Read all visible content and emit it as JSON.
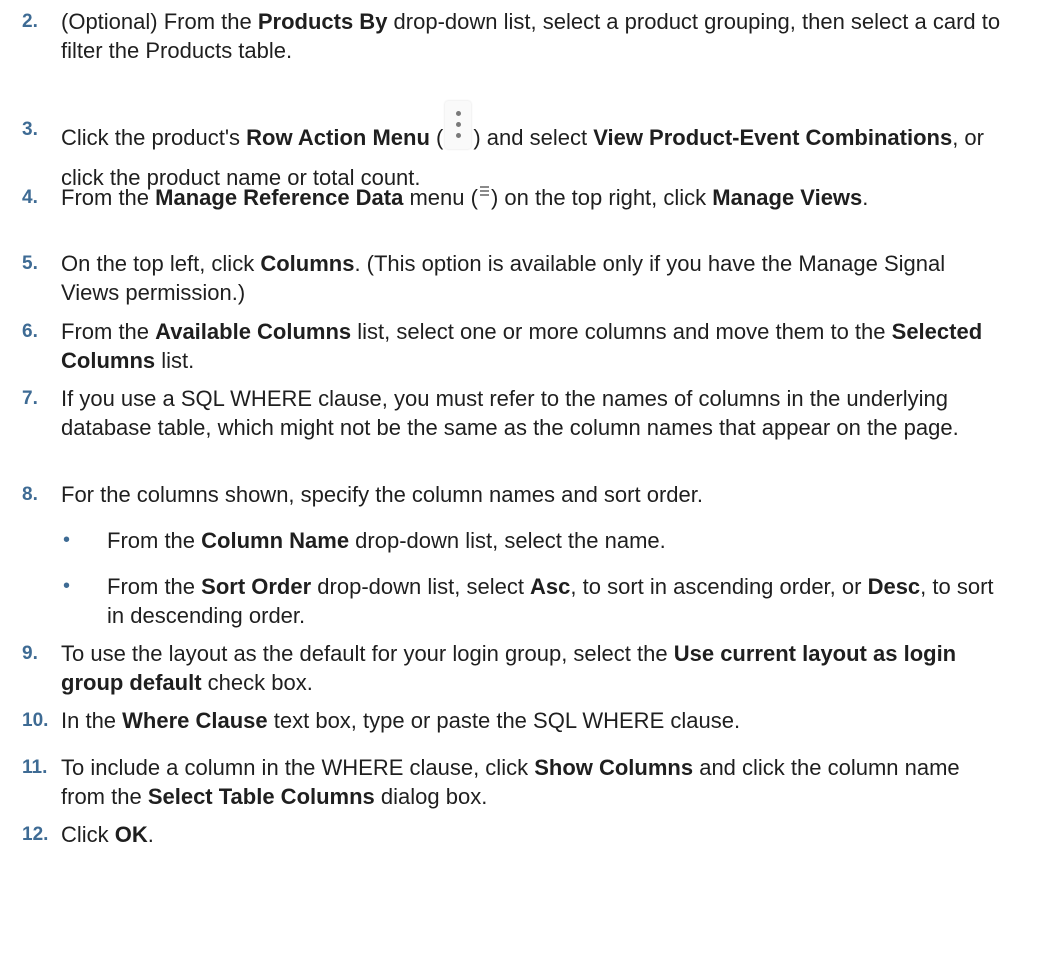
{
  "steps": [
    {
      "num": "2.",
      "parts": [
        "(Optional) From the ",
        "Products By",
        " drop-down list, select a product grouping, then select a card to filter the Products table."
      ]
    },
    {
      "num": "3.",
      "p1": "Click the product's ",
      "b1": "Row Action Menu",
      "p2": " (",
      "p3": ") and select ",
      "b2": "View Product-Event Combinations",
      "p4": ", or click the product name or total count."
    },
    {
      "num": "4.",
      "p1": "From the ",
      "b1": "Manage Reference Data",
      "p2": " menu (",
      "p3": ") on the top right, click ",
      "b2": "Manage Views",
      "p4": "."
    },
    {
      "num": "5.",
      "p1": "On the top left, click ",
      "b1": "Columns",
      "p2": ". (This option is available only if you have the Manage Signal Views permission.)"
    },
    {
      "num": "6.",
      "p1": "From the ",
      "b1": "Available Columns",
      "p2": " list, select one or more columns and move them to the ",
      "b2": "Selected Columns",
      "p3": " list."
    },
    {
      "num": "7.",
      "p1": "If you use a SQL WHERE clause, you must refer to the names of columns in the underlying database table, which might not be the same as the column names that appear on the page."
    },
    {
      "num": "8.",
      "p1": "For the columns shown, specify the column names and sort order."
    },
    {
      "num": "9.",
      "p1": "To use the layout as the default for your login group, select the ",
      "b1": "Use current layout as login group default",
      "p2": " check box."
    },
    {
      "num": "10.",
      "p1": "In the ",
      "b1": "Where Clause",
      "p2": " text box, type or paste the SQL WHERE clause."
    },
    {
      "num": "11.",
      "p1": "To include a column in the WHERE clause, click ",
      "b1": "Show Columns",
      "p2": " and click the column name from the ",
      "b2": "Select Table Columns",
      "p3": " dialog box."
    },
    {
      "num": "12.",
      "p1": "Click ",
      "b1": "OK",
      "p2": "."
    }
  ],
  "substeps": [
    {
      "bullet": "•",
      "p1": "From the ",
      "b1": "Column Name",
      "p2": " drop-down list, select the name."
    },
    {
      "bullet": "•",
      "p1": "From the ",
      "b1": "Sort Order",
      "p2": " drop-down list, select ",
      "b2": "Asc",
      "p3": ", to sort in ascending order, or ",
      "b3": "Desc",
      "p4": ", to sort in descending order."
    }
  ],
  "icons": {
    "row_action_menu": "kebab-vertical-icon",
    "manage_reference_data_menu": "hamburger-menu-icon"
  }
}
